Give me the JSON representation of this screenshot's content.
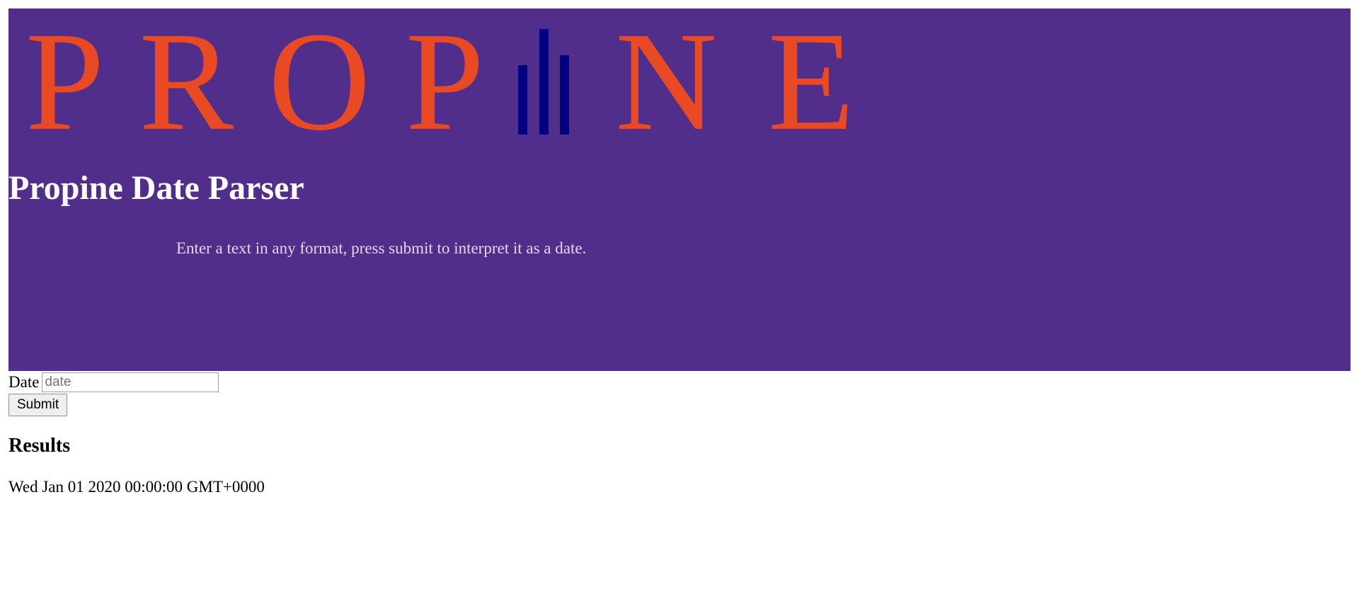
{
  "header": {
    "logo_text_left": "PROP",
    "logo_text_right": "NE",
    "title": "Propine Date Parser",
    "subtitle": "Enter a text in any format, press submit to interpret it as a date.",
    "colors": {
      "background": "#522e8b",
      "logo_letters": "#ea4a23",
      "logo_bars": "#000080",
      "title": "#ffffff",
      "subtitle": "#e3d6f0"
    }
  },
  "form": {
    "date_label": "Date",
    "date_value": "",
    "date_placeholder": "date",
    "submit_label": "Submit"
  },
  "results": {
    "heading": "Results",
    "value": "Wed Jan 01 2020 00:00:00 GMT+0000"
  }
}
